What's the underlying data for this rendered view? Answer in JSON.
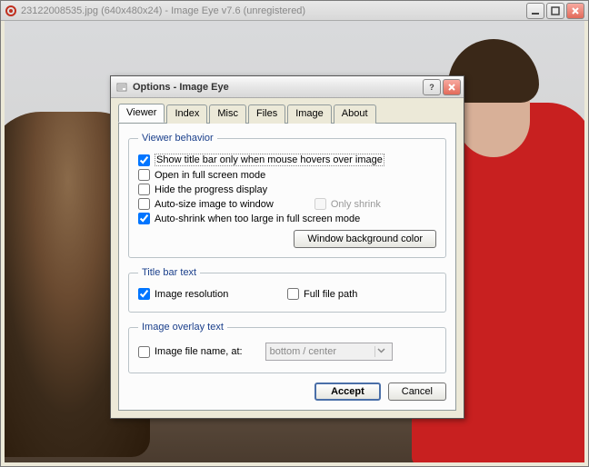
{
  "main_window": {
    "title": "23122008535.jpg (640x480x24) - Image Eye v7.6 (unregistered)"
  },
  "dialog": {
    "title": "Options - Image Eye",
    "tabs": [
      "Viewer",
      "Index",
      "Misc",
      "Files",
      "Image",
      "About"
    ],
    "active_tab": "Viewer",
    "viewer_behavior": {
      "legend": "Viewer behavior",
      "show_title_hover": {
        "label": "Show title bar only when mouse hovers over image",
        "checked": true
      },
      "open_fullscreen": {
        "label": "Open in full screen mode",
        "checked": false
      },
      "hide_progress": {
        "label": "Hide the progress display",
        "checked": false
      },
      "auto_size": {
        "label": "Auto-size image to window",
        "checked": false
      },
      "only_shrink": {
        "label": "Only shrink",
        "checked": false
      },
      "auto_shrink_fs": {
        "label": "Auto-shrink when too large in full screen mode",
        "checked": true
      },
      "bg_color_button": "Window background color"
    },
    "title_bar_text": {
      "legend": "Title bar text",
      "image_resolution": {
        "label": "Image resolution",
        "checked": true
      },
      "full_file_path": {
        "label": "Full file path",
        "checked": false
      }
    },
    "overlay": {
      "legend": "Image overlay text",
      "file_name_at": {
        "label": "Image file name, at:",
        "checked": false
      },
      "position": "bottom / center"
    },
    "buttons": {
      "accept": "Accept",
      "cancel": "Cancel"
    }
  }
}
